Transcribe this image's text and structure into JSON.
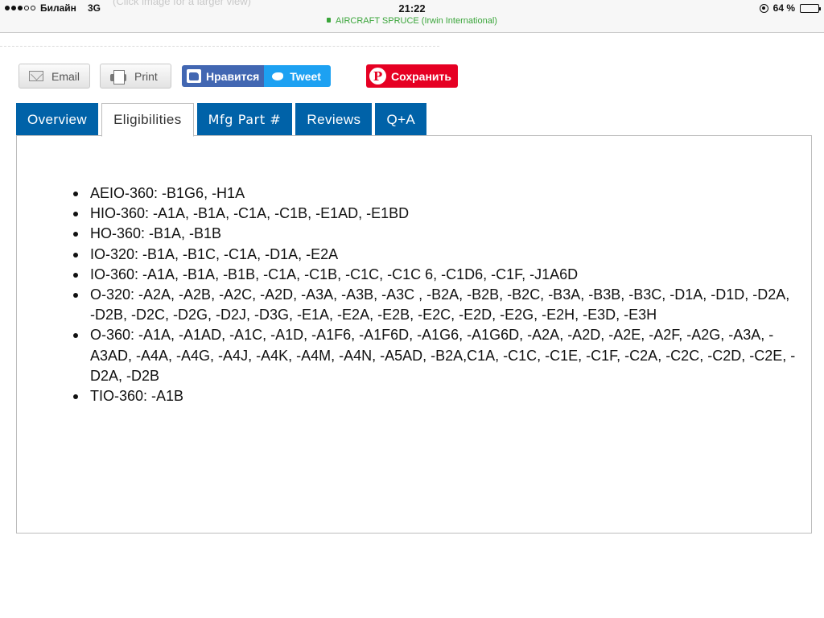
{
  "status_bar": {
    "carrier": "Билайн",
    "network": "3G",
    "time": "21:22",
    "url": "AIRCRAFT SPRUCE (Irwin International)",
    "battery": "64 %",
    "battery_level": 0.64,
    "ghost_text": "(Click image for a larger view)"
  },
  "share": {
    "email_label": "Email",
    "print_label": "Print",
    "facebook_label": "Нравится",
    "tweet_label": "Tweet",
    "pinterest_label": "Сохранить"
  },
  "tabs": [
    {
      "label": "Overview",
      "active": false
    },
    {
      "label": "Eligibilities",
      "active": true
    },
    {
      "label": "Mfg Part #",
      "active": false
    },
    {
      "label": "Reviews",
      "active": false
    },
    {
      "label": "Q+A",
      "active": false
    }
  ],
  "eligibilities": [
    "AEIO-360: -B1G6, -H1A",
    "HIO-360: -A1A, -B1A, -C1A, -C1B, -E1AD, -E1BD",
    "HO-360: -B1A, -B1B",
    "IO-320: -B1A, -B1C, -C1A, -D1A, -E2A",
    "IO-360: -A1A, -B1A, -B1B, -C1A, -C1B, -C1C, -C1C 6, -C1D6, -C1F, -J1A6D",
    "O-320: -A2A, -A2B, -A2C, -A2D, -A3A, -A3B, -A3C , -B2A, -B2B, -B2C, -B3A, -B3B, -B3C, -D1A, -D1D, -D2A, -D2B, -D2C, -D2G, -D2J, -D3G, -E1A, -E2A, -E2B, -E2C, -E2D, -E2G, -E2H, -E3D, -E3H",
    "O-360: -A1A, -A1AD, -A1C, -A1D, -A1F6, -A1F6D, -A1G6, -A1G6D, -A2A, -A2D, -A2E, -A2F, -A2G, -A3A, -A3AD, -A4A, -A4G, -A4J, -A4K, -A4M, -A4N, -A5AD, -B2A,C1A, -C1C, -C1E, -C1F, -C2A, -C2C, -C2D, -C2E, -D2A, -D2B",
    "TIO-360: -A1B"
  ]
}
